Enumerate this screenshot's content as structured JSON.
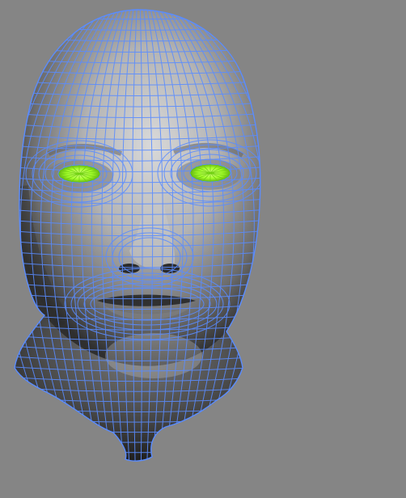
{
  "viewport": {
    "background": "#858585",
    "shading": "smooth-shaded-with-wireframe",
    "object": "head-mesh"
  },
  "colors": {
    "wireframe": "#5a8cff",
    "eye_selection": "#a4ff2a",
    "skin_light": "#d6d6d6",
    "skin_mid": "#9a9a9a",
    "skin_dark": "#2e2e2e"
  }
}
